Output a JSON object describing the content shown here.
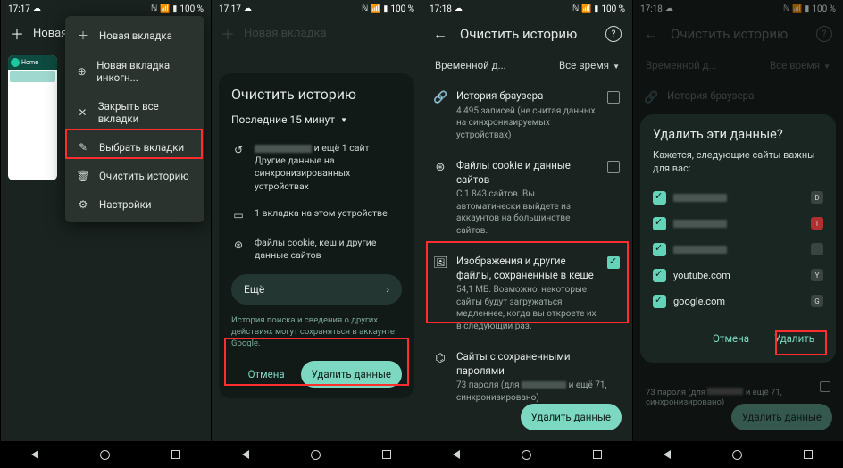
{
  "status": {
    "time1": "17:17",
    "time3": "17:18",
    "battery": "100 %"
  },
  "screen1": {
    "toolbar_new": "Новая...",
    "thumb_label": "Home",
    "menu": [
      {
        "icon": "＋",
        "label": "Новая вкладка"
      },
      {
        "icon": "⊕",
        "label": "Новая вкладка инкогн..."
      },
      {
        "icon": "✕",
        "label": "Закрыть все вкладки"
      },
      {
        "icon": "✎",
        "label": "Выбрать вкладки"
      },
      {
        "icon": "🗑",
        "label": "Очистить историю"
      },
      {
        "icon": "⚙",
        "label": "Настройки"
      }
    ]
  },
  "screen2": {
    "toolbar_new": "Новая вкладка",
    "title": "Очистить историю",
    "timerange": "Последние 15 минут",
    "row0_suffix": " и ещё 1 сайт",
    "row0_sub": "Другие данные на синхронизированных устройствах",
    "row1": "1 вкладка на этом устройстве",
    "row2": "Файлы cookie, кеш и другие данные сайтов",
    "more": "Ещё",
    "footnote": "История поиска и сведения о других действиях могут сохраняться в аккаунте Google.",
    "cancel": "Отмена",
    "confirm": "Удалить данные"
  },
  "screen3": {
    "title": "Очистить историю",
    "range_label": "Временной д...",
    "range_value": "Все время",
    "opt0_t": "История браузера",
    "opt0_s": "4 495 записей (не считая данных на синхронизируемых устройствах)",
    "opt1_t": "Файлы cookie и данные сайтов",
    "opt1_s": "С 1 843 сайтов. Вы автоматически выйдете из аккаунтов на большинстве сайтов.",
    "opt2_t": "Изображения и другие файлы, сохраненные в кеше",
    "opt2_s": "54,1 МБ. Возможно, некоторые сайты будут загружаться медленнее, когда вы откроете их в следующий раз.",
    "opt3_t": "Сайты с сохраненными паролями",
    "opt3_s_a": "73 пароля (для ",
    "opt3_s_b": " и ещё 71, синхронизировано)",
    "confirm": "Удалить данные"
  },
  "screen4": {
    "title": "Очистить историю",
    "range_label": "Временной д...",
    "range_value": "Все время",
    "bg_label": "История браузера",
    "dlg_title": "Удалить эти данные?",
    "dlg_sub": "Кажется, следующие сайты важны для вас:",
    "sites": [
      {
        "blur": true,
        "badge": "D"
      },
      {
        "blur": true,
        "badge": "I",
        "red": true
      },
      {
        "blur": true,
        "badge": ""
      },
      {
        "label": "youtube.com",
        "badge": "Y"
      },
      {
        "label": "google.com",
        "badge": "G"
      }
    ],
    "cancel": "Отмена",
    "confirm": "Удалить",
    "bg_pw_a": "73 пароля (для",
    "bg_pw_b": " и ещё 71, синхронизировано)",
    "bg_btn": "Удалить данные"
  }
}
